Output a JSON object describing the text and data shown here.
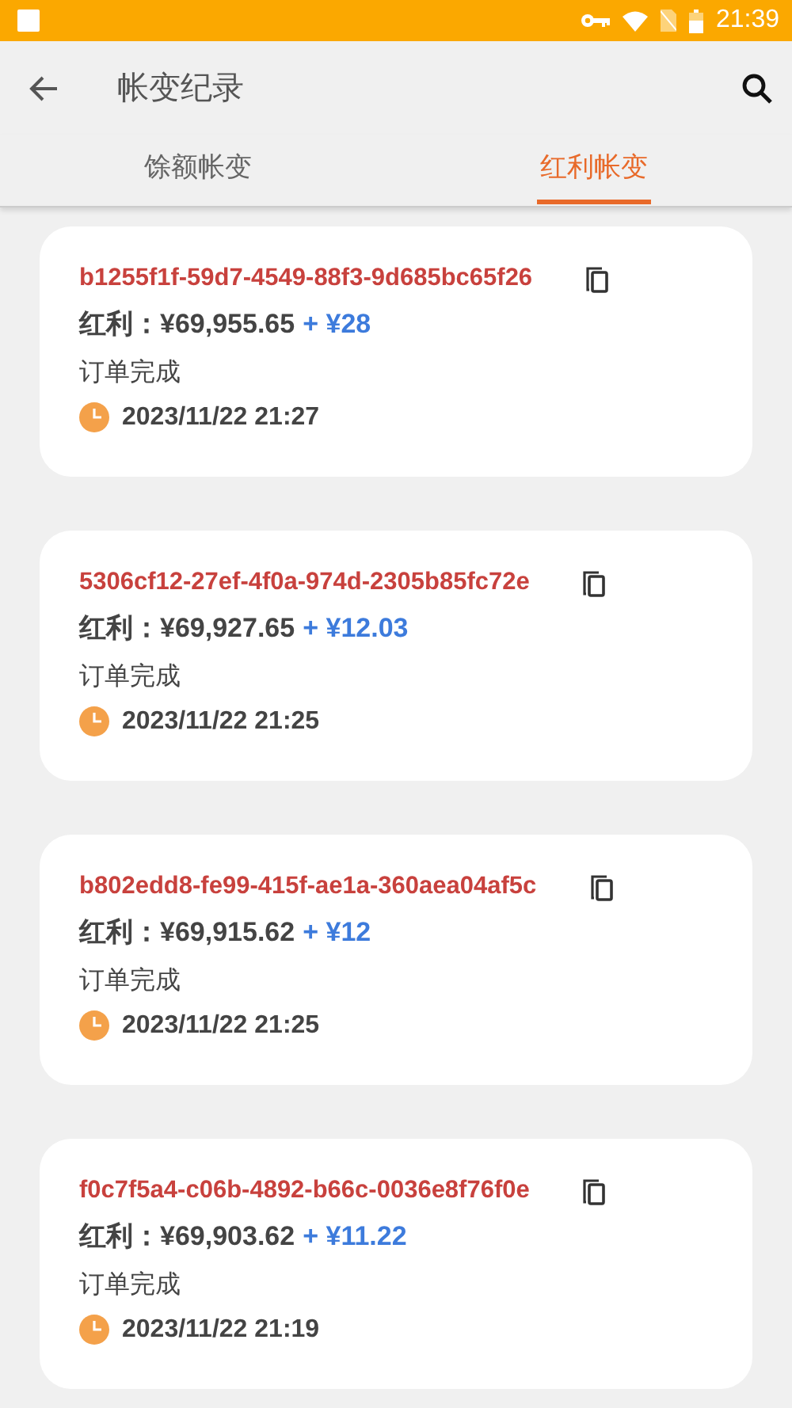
{
  "status_bar": {
    "time": "21:39"
  },
  "app_bar": {
    "title": "帐变纪录"
  },
  "tabs": [
    {
      "label": "馀额帐变",
      "selected": false
    },
    {
      "label": "红利帐变",
      "selected": true
    }
  ],
  "records": [
    {
      "id": "b1255f1f-59d7-4549-88f3-9d685bc65f26",
      "balance": "红利：¥69,955.65",
      "change": "+ ¥28",
      "status": "订单完成",
      "time": "2023/11/22 21:27"
    },
    {
      "id": "5306cf12-27ef-4f0a-974d-2305b85fc72e",
      "balance": "红利：¥69,927.65",
      "change": "+ ¥12.03",
      "status": "订单完成",
      "time": "2023/11/22 21:25"
    },
    {
      "id": "b802edd8-fe99-415f-ae1a-360aea04af5c",
      "balance": "红利：¥69,915.62",
      "change": "+ ¥12",
      "status": "订单完成",
      "time": "2023/11/22 21:25"
    },
    {
      "id": "f0c7f5a4-c06b-4892-b66c-0036e8f76f0e",
      "balance": "红利：¥69,903.62",
      "change": "+ ¥11.22",
      "status": "订单完成",
      "time": "2023/11/22 21:19"
    }
  ]
}
